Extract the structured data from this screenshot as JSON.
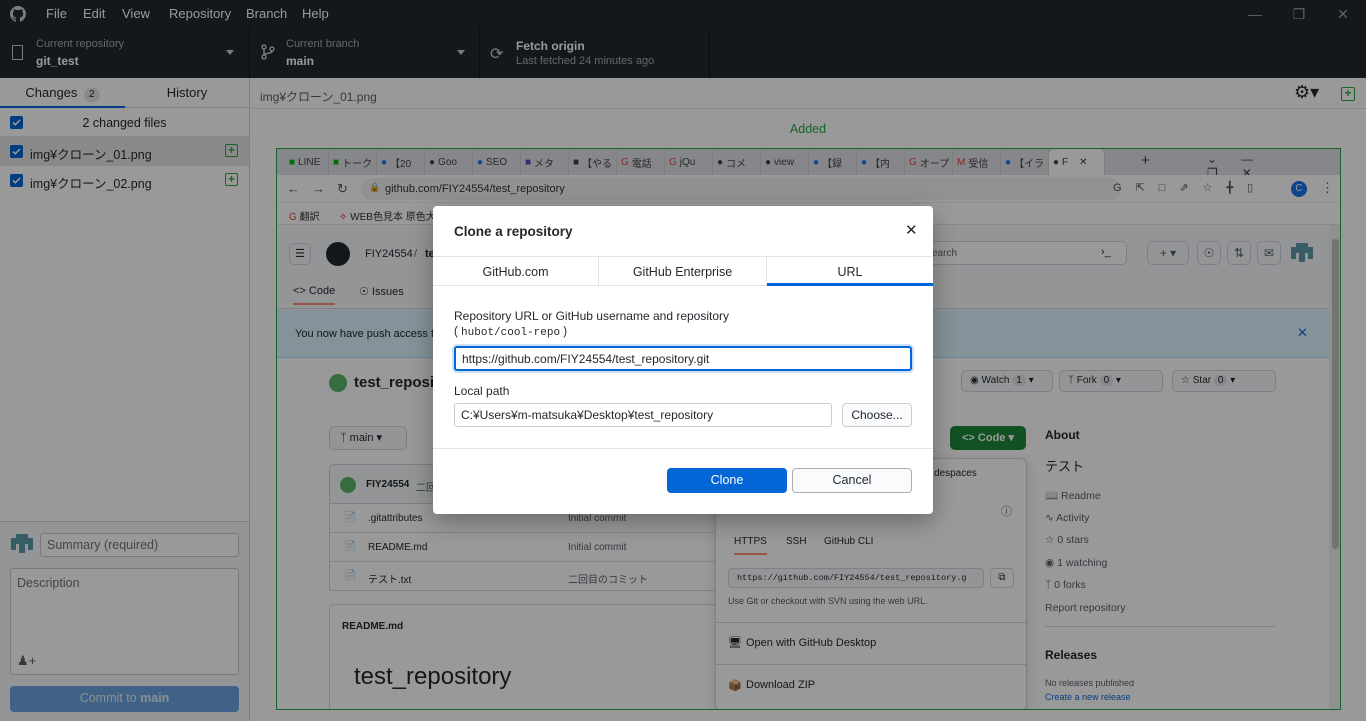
{
  "menu": [
    "File",
    "Edit",
    "View",
    "Repository",
    "Branch",
    "Help"
  ],
  "toolbar": {
    "repo_label": "Current repository",
    "repo_value": "git_test",
    "branch_label": "Current branch",
    "branch_value": "main",
    "fetch_label": "Fetch origin",
    "fetch_sub": "Last fetched 24 minutes ago"
  },
  "sidebar": {
    "tab_changes": "Changes",
    "changes_count": "2",
    "tab_history": "History",
    "changed_files": "2 changed files",
    "files": [
      "img¥クローン_01.png",
      "img¥クローン_02.png"
    ],
    "summary_placeholder": "Summary (required)",
    "description_placeholder": "Description",
    "commit_prefix": "Commit to ",
    "commit_branch": "main"
  },
  "diff": {
    "path": "img¥クローン_01.png",
    "status": "Added"
  },
  "screenshot": {
    "tabs": [
      "LINE",
      "トーク",
      "【20",
      "Goo",
      "SEO",
      "メタ",
      "【やる",
      "電話",
      "jQu",
      "コメ",
      "view",
      "【録",
      "【内",
      "オープ",
      "受信",
      "【イラ",
      "F"
    ],
    "url": "github.com/FIY24554/test_repository",
    "bookmarks": [
      "翻訳",
      "WEB色見本 原色大"
    ],
    "owner": "FIY24554",
    "repo_short": "te",
    "nav_code": "Code",
    "nav_issues": "Issues",
    "push_notice": "You now have push access to",
    "repo_title": "test_reposit",
    "watch": "Watch",
    "watch_count": "1",
    "fork": "Fork",
    "fork_count": "0",
    "star": "Star",
    "star_count": "0",
    "branch_btn": "main",
    "code_btn": "Code",
    "commit_user": "FIY24554",
    "commit_msg_short": "二回",
    "files": [
      {
        "name": ".gitattributes",
        "msg": "Initial commit"
      },
      {
        "name": "README.md",
        "msg": "Initial commit"
      },
      {
        "name": "テスト.txt",
        "msg": "二回目のコミット"
      }
    ],
    "readme_label": "README.md",
    "readme_heading": "test_repository",
    "codespaces": "despaces",
    "clone_tabs": [
      "HTTPS",
      "SSH",
      "GitHub CLI"
    ],
    "clone_url": "https://github.com/FIY24554/test_repository.g",
    "clone_help": "Use Git or checkout with SVN using the web URL.",
    "open_desktop": "Open with GitHub Desktop",
    "download_zip": "Download ZIP",
    "about_title": "About",
    "about_desc": "テスト",
    "about_items": [
      "Readme",
      "Activity",
      "0 stars",
      "1 watching",
      "0 forks"
    ],
    "report": "Report repository",
    "releases_title": "Releases",
    "no_releases": "No releases published",
    "create_release": "Create a new release",
    "search_placeholder": "earch"
  },
  "dialog": {
    "title": "Clone a repository",
    "tabs": [
      "GitHub.com",
      "GitHub Enterprise",
      "URL"
    ],
    "url_label": "Repository URL or GitHub username and repository",
    "url_hint_open": "(",
    "url_hint_code": "hubot/cool-repo",
    "url_hint_close": ")",
    "url_value": "https://github.com/FIY24554/test_repository.git",
    "path_label": "Local path",
    "path_value": "C:¥Users¥m-matsuka¥Desktop¥test_repository",
    "choose": "Choose...",
    "clone": "Clone",
    "cancel": "Cancel"
  },
  "colors": {
    "accent": "#0366d6",
    "added": "#28a745",
    "dark": "#24292e"
  }
}
